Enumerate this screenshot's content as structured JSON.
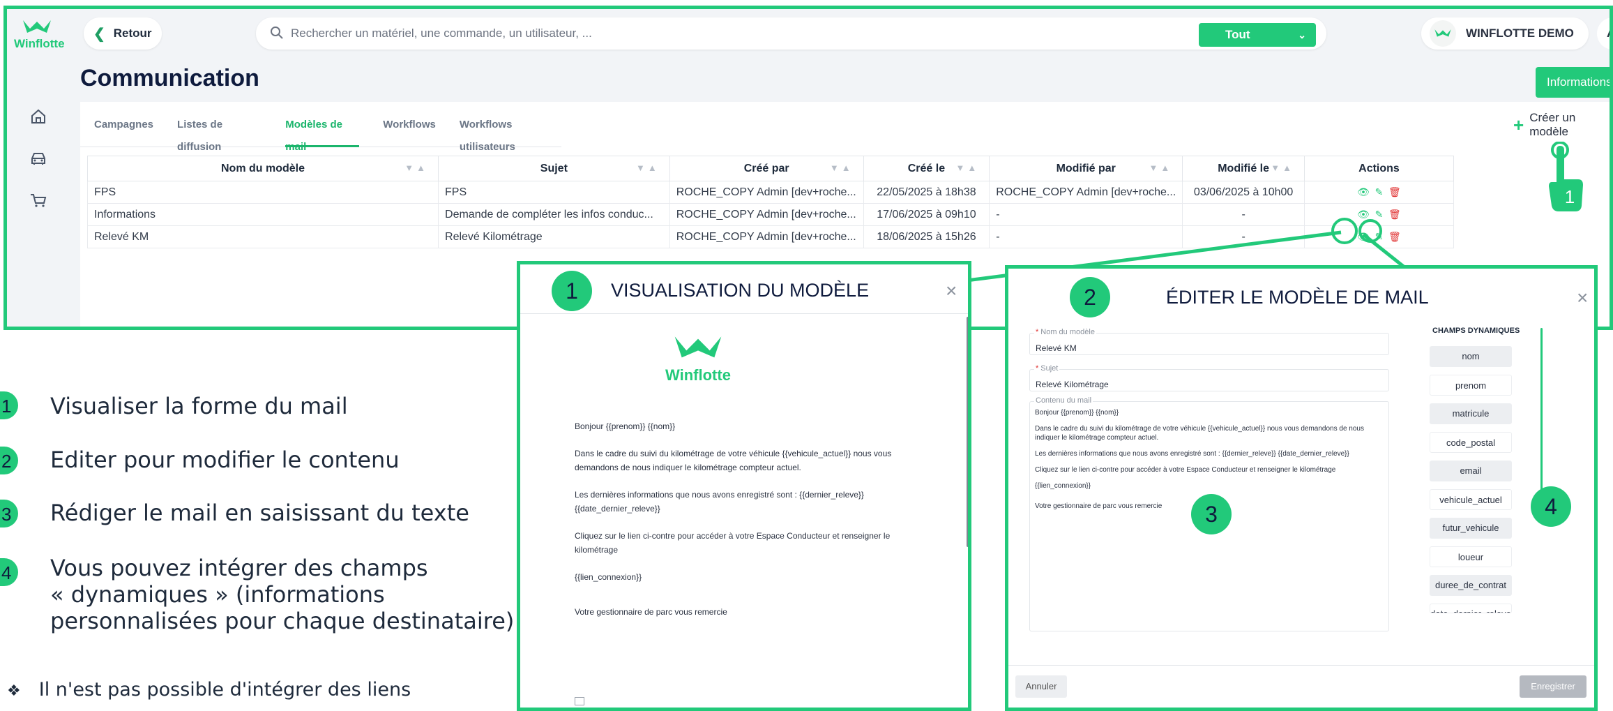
{
  "app": {
    "logo_text": "Winflotte",
    "back_label": "Retour",
    "search": {
      "placeholder": "Rechercher un matériel, une commande, un utilisateur, ..."
    },
    "filter_value": "Tout",
    "account_name": "WINFLOTTE DEMO",
    "user_initials": "AR",
    "page_title": "Communication",
    "info_button": "Informations",
    "create_button": "Créer un modèle",
    "tabs": [
      {
        "label": "Campagnes"
      },
      {
        "label": "Listes de diffusion"
      },
      {
        "label": "Modèles de mail",
        "active": true
      },
      {
        "label": "Workflows"
      },
      {
        "label": "Workflows utilisateurs"
      }
    ],
    "table": {
      "columns": [
        "Nom du modèle",
        "Sujet",
        "Créé par",
        "Créé le",
        "Modifié par",
        "Modifié le",
        "Actions"
      ],
      "rows": [
        [
          "FPS",
          "FPS",
          "ROCHE_COPY Admin [dev+roche...",
          "22/05/2025 à 18h38",
          "ROCHE_COPY Admin [dev+roche...",
          "03/06/2025 à 10h00"
        ],
        [
          "Informations",
          "Demande de compléter les infos conduc...",
          "ROCHE_COPY Admin [dev+roche...",
          "17/06/2025 à 09h10",
          "-",
          "-"
        ],
        [
          "Relevé KM",
          "Relevé Kilométrage",
          "ROCHE_COPY Admin [dev+roche...",
          "18/06/2025 à 15h26",
          "-",
          "-"
        ]
      ]
    },
    "hand_number": "1"
  },
  "legend": [
    {
      "num": "1",
      "text": "Visualiser la forme du mail"
    },
    {
      "num": "2",
      "text": "Editer pour modifier le contenu"
    },
    {
      "num": "3",
      "text": "Rédiger le mail en saisissant du texte"
    },
    {
      "num": "4",
      "text_lines": [
        "Vous pouvez intégrer des champs",
        "« dynamiques » (informations",
        "personnalisées pour chaque destinataire)"
      ]
    }
  ],
  "note": {
    "bullet": "❖",
    "text": "Il n'est pas possible d'intégrer des liens"
  },
  "preview_popup": {
    "num": "1",
    "title": "VISUALISATION DU MODÈLE",
    "logo_text": "Winflotte",
    "paragraphs": [
      "Bonjour {{prenom}} {{nom}}",
      "Dans le cadre du suivi du kilométrage de votre véhicule {{vehicule_actuel}} nous vous demandons de nous indiquer le kilométrage compteur actuel.",
      "Les dernières informations que nous avons enregistré sont : {{dernier_releve}} {{date_dernier_releve}}",
      "Cliquez sur le lien ci-contre pour accéder à votre Espace Conducteur et renseigner le kilométrage",
      "{{lien_connexion}}",
      "Votre gestionnaire de parc vous remercie"
    ]
  },
  "edit_popup": {
    "num": "2",
    "title": "ÉDITER LE MODÈLE DE MAIL",
    "name_label": "Nom du modèle",
    "name_value": "Relevé KM",
    "subject_label": "Sujet",
    "subject_value": "Relevé Kilométrage",
    "content_label": "Contenu du mail",
    "content_paragraphs": [
      "Bonjour {{prenom}} {{nom}}",
      "Dans le cadre du suivi du kilométrage de votre véhicule {{vehicule_actuel}} nous vous demandons de nous indiquer le kilométrage compteur actuel.",
      "Les dernières informations que nous avons enregistré sont : {{dernier_releve}} {{date_dernier_releve}}",
      "Cliquez sur le lien ci-contre pour accéder à votre Espace Conducteur et renseigner le kilométrage",
      "{{lien_connexion}}",
      "Votre gestionnaire de parc vous remercie"
    ],
    "marker_content": "3",
    "marker_fields": "4",
    "dynamic_title": "CHAMPS DYNAMIQUES",
    "dynamic_fields": [
      "nom",
      "prenom",
      "matricule",
      "code_postal",
      "email",
      "vehicule_actuel",
      "futur_vehicule",
      "loueur",
      "duree_de_contrat",
      "date_dernier_releve"
    ],
    "cancel_label": "Annuler",
    "save_label": "Enregistrer"
  },
  "colors": {
    "accent": "#22c97a",
    "danger": "#e03131",
    "title": "#0f1b3d"
  }
}
